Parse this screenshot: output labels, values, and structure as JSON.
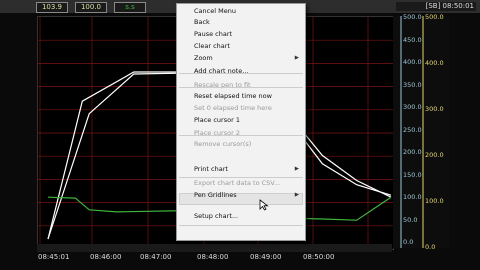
{
  "top": {
    "values": [
      "103.9",
      "100.0",
      "ѕ.ѕ"
    ],
    "value_colors": [
      "#d8e0a0",
      "#d8e0a0",
      "#3db53d"
    ],
    "sb_time": "[SB] 08:50:01"
  },
  "axis": {
    "ticks_left": [
      "500.0",
      "450.0",
      "400.0",
      "350.0",
      "300.0",
      "250.0",
      "200.0",
      "150.0",
      "100.0",
      "50.0",
      "0.0"
    ],
    "ticks_right": [
      "500.0",
      "400.0",
      "300.0",
      "200.0",
      "100.0",
      "0.0"
    ],
    "left_color": "#9ec8d8",
    "right_color": "#e8d870"
  },
  "x_ticks": [
    "08:45:01",
    "08:46:00",
    "08:47:00",
    "08:48:00",
    "08:49:00",
    "08:50:00"
  ],
  "context_menu": {
    "items": [
      {
        "label": "Cancel Menu",
        "enabled": true
      },
      {
        "label": "Back",
        "enabled": true
      },
      {
        "label": "Pause chart",
        "enabled": true
      },
      {
        "label": "Clear chart",
        "enabled": true
      },
      {
        "label": "Zoom",
        "enabled": true,
        "submenu": true
      },
      {
        "label": "Add chart note...",
        "enabled": true
      },
      {
        "label": "Rescale pen to fit",
        "enabled": false
      },
      {
        "label": "Reset elapsed time now",
        "enabled": true
      },
      {
        "label": "Set 0 elapsed time here",
        "enabled": false
      },
      {
        "label": "Place cursor 1",
        "enabled": true
      },
      {
        "label": "Place cursor 2",
        "enabled": false
      },
      {
        "label": "Remove cursor(s)",
        "enabled": false
      },
      {
        "label": "Print chart",
        "enabled": true,
        "submenu": true
      },
      {
        "label": "Export chart data to CSV...",
        "enabled": false
      },
      {
        "label": "Pen Gridlines",
        "enabled": true,
        "submenu": true
      },
      {
        "label": "Setup chart...",
        "enabled": true
      }
    ],
    "submenu_arrow": "▶"
  },
  "chart_data": {
    "type": "line",
    "x": [
      "08:45:01",
      "08:46:00",
      "08:47:00",
      "08:48:00",
      "08:49:00",
      "08:50:00"
    ],
    "series": [
      {
        "color": "#ffffff",
        "points": [
          [
            0,
            0
          ],
          [
            0.1,
            330
          ],
          [
            0.25,
            400
          ],
          [
            0.45,
            400
          ],
          [
            0.62,
            400
          ],
          [
            0.7,
            300
          ],
          [
            0.8,
            200
          ],
          [
            0.9,
            140
          ],
          [
            1.0,
            100
          ]
        ]
      },
      {
        "color": "#ffffff",
        "points": [
          [
            0,
            0
          ],
          [
            0.12,
            300
          ],
          [
            0.25,
            395
          ],
          [
            0.45,
            398
          ],
          [
            0.62,
            398
          ],
          [
            0.66,
            330
          ],
          [
            0.8,
            180
          ],
          [
            0.9,
            130
          ],
          [
            1.0,
            105
          ]
        ]
      },
      {
        "color": "#3db53d",
        "points": [
          [
            0,
            100
          ],
          [
            0.08,
            98
          ],
          [
            0.12,
            70
          ],
          [
            0.2,
            65
          ],
          [
            0.4,
            68
          ],
          [
            0.62,
            66
          ],
          [
            0.7,
            50
          ],
          [
            0.8,
            48
          ],
          [
            0.9,
            45
          ],
          [
            1.0,
            100
          ]
        ]
      }
    ],
    "ylim": [
      0,
      500
    ],
    "grid": true
  }
}
